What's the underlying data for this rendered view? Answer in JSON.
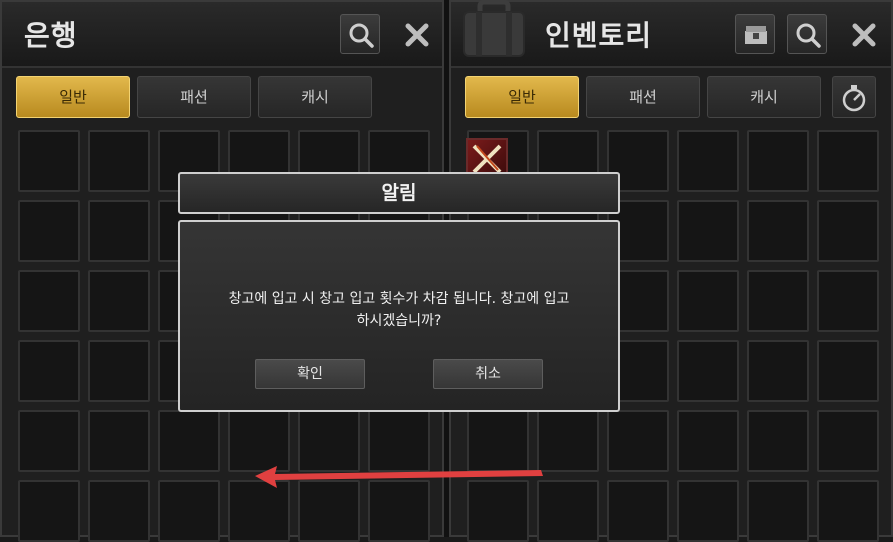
{
  "bank": {
    "title": "은행",
    "tabs": [
      {
        "label": "일반",
        "active": true
      },
      {
        "label": "패션",
        "active": false
      },
      {
        "label": "캐시",
        "active": false
      }
    ]
  },
  "inventory": {
    "title": "인벤토리",
    "tabs": [
      {
        "label": "일반",
        "active": true
      },
      {
        "label": "패션",
        "active": false
      },
      {
        "label": "캐시",
        "active": false
      }
    ]
  },
  "dialog": {
    "title": "알림",
    "message_line1": "창고에 입고 시 창고 입고 횟수가 차감 됩니다. 창고에 입고",
    "message_line2": "하시겠습니까?",
    "confirm_label": "확인",
    "cancel_label": "취소"
  },
  "icons": {
    "bank_search": "search-icon",
    "bank_close": "close-icon",
    "inventory_bag": "bag-icon",
    "inventory_chest": "chest-icon",
    "inventory_search": "search-icon",
    "inventory_close": "close-icon",
    "inventory_timer": "stopwatch-icon"
  },
  "colors": {
    "active_tab": "#d4a83a",
    "annotation_arrow": "#e04040"
  }
}
